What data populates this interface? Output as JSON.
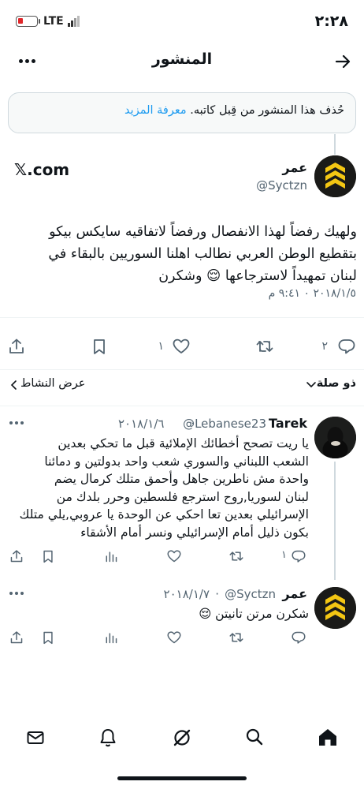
{
  "status_bar": {
    "time": "٢:٢٨",
    "network": "LTE"
  },
  "header": {
    "title": "المنشور"
  },
  "notice": {
    "text": "حُذف هذا المنشور من قِبل كاتبه.",
    "link": "معرفة المزيد"
  },
  "post": {
    "author_name": "عمر",
    "author_handle": "@Syctzn",
    "source": "𝕏.com",
    "text_lines": [
      "ولهيك رفضاً لهذا الانفصال ورفضاً لاتفاقيه سايكس بيكو",
      "بتقطيع الوطن العربي نطالب اهلنا السوريين بالبقاء في",
      "لبنان تمهيداً لاسترجاعها 😌 وشكرن"
    ],
    "timestamp": "٢٠١٨/١/٥ ٠ ٩:٤١ م",
    "reply_count": "٢",
    "like_count": "١",
    "relevance_label": "ذو صلة",
    "activity_label": "عرض النشاط"
  },
  "replies": [
    {
      "author_name": "Tarek",
      "author_handle": "@Lebanese23",
      "date": "٢٠١٨/١/٦",
      "text_lines": [
        "يا ريت تصحح أخطائك الإملائية قبل ما تحكي بعدين",
        "الشعب اللبناني والسوري شعب واحد بدولتين و دمائنا",
        "واحدة مش ناطرين جاهل وأحمق متلك كرمال يضم",
        "لبنان لسوريا,روح استرجع فلسطين وحرر بلدك من",
        "الإسرائيلي بعدين تعا احكي عن الوحدة يا عروبي,يلي متلك",
        "بكون ذليل أمام الإسرائيلي ونسر أمام الأشقاء"
      ],
      "reply_count": "١"
    },
    {
      "author_name": "عمر",
      "author_handle": "@Syctzn",
      "date": "٢٠١٨/١/٧",
      "text_lines": [
        "شكرن مرتن تانيتن 😌"
      ],
      "reply_count": ""
    }
  ],
  "bottom_nav": [
    "home-icon",
    "search-icon",
    "grok-icon",
    "notifications-icon",
    "messages-icon"
  ]
}
